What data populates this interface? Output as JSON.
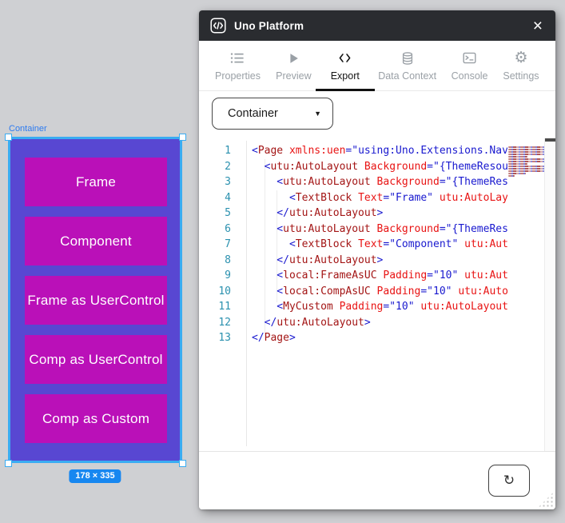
{
  "window": {
    "title": "Uno Platform",
    "icons": {
      "close": "×",
      "caret_down": "▼",
      "refresh": "↻",
      "settings_gear": "⚙"
    }
  },
  "tabs": [
    {
      "id": "properties",
      "label": "Properties",
      "icon": "properties-icon",
      "active": false
    },
    {
      "id": "preview",
      "label": "Preview",
      "icon": "preview-icon",
      "active": false
    },
    {
      "id": "export",
      "label": "Export",
      "icon": "export-icon",
      "active": true
    },
    {
      "id": "data-context",
      "label": "Data Context",
      "icon": "data-context-icon",
      "active": false
    },
    {
      "id": "console",
      "label": "Console",
      "icon": "console-icon",
      "active": false
    },
    {
      "id": "settings",
      "label": "Settings",
      "icon": "settings-icon",
      "active": false
    }
  ],
  "export_panel": {
    "element_selector": {
      "value": "Container"
    },
    "code": {
      "lines": [
        {
          "n": "1",
          "tokens": [
            {
              "c": "d",
              "t": "<"
            },
            {
              "c": "t",
              "t": "Page "
            },
            {
              "c": "a",
              "t": "xmlns:uen"
            },
            {
              "c": "d",
              "t": "=\"using:Uno.Extensions.Navi"
            }
          ]
        },
        {
          "n": "2",
          "tokens": [
            {
              "c": "d",
              "t": "  <"
            },
            {
              "c": "t",
              "t": "utu:AutoLayout "
            },
            {
              "c": "a",
              "t": "Background"
            },
            {
              "c": "d",
              "t": "=\"{ThemeResou"
            }
          ]
        },
        {
          "n": "3",
          "tokens": [
            {
              "c": "d",
              "t": "    <"
            },
            {
              "c": "t",
              "t": "utu:AutoLayout "
            },
            {
              "c": "a",
              "t": "Background"
            },
            {
              "c": "d",
              "t": "=\"{ThemeRes"
            }
          ]
        },
        {
          "n": "4",
          "tokens": [
            {
              "c": "d",
              "t": "      <"
            },
            {
              "c": "t",
              "t": "TextBlock "
            },
            {
              "c": "a",
              "t": "Text"
            },
            {
              "c": "d",
              "t": "=\"Frame\" "
            },
            {
              "c": "a",
              "t": "utu:AutoLay"
            }
          ]
        },
        {
          "n": "5",
          "tokens": [
            {
              "c": "d",
              "t": "    </"
            },
            {
              "c": "t",
              "t": "utu:AutoLayout"
            },
            {
              "c": "d",
              "t": ">"
            }
          ]
        },
        {
          "n": "6",
          "tokens": [
            {
              "c": "d",
              "t": "    <"
            },
            {
              "c": "t",
              "t": "utu:AutoLayout "
            },
            {
              "c": "a",
              "t": "Background"
            },
            {
              "c": "d",
              "t": "=\"{ThemeRes"
            }
          ]
        },
        {
          "n": "7",
          "tokens": [
            {
              "c": "d",
              "t": "      <"
            },
            {
              "c": "t",
              "t": "TextBlock "
            },
            {
              "c": "a",
              "t": "Text"
            },
            {
              "c": "d",
              "t": "=\"Component\" "
            },
            {
              "c": "a",
              "t": "utu:Aut"
            }
          ]
        },
        {
          "n": "8",
          "tokens": [
            {
              "c": "d",
              "t": "    </"
            },
            {
              "c": "t",
              "t": "utu:AutoLayout"
            },
            {
              "c": "d",
              "t": ">"
            }
          ]
        },
        {
          "n": "9",
          "tokens": [
            {
              "c": "d",
              "t": "    <"
            },
            {
              "c": "t",
              "t": "local:FrameAsUC "
            },
            {
              "c": "a",
              "t": "Padding"
            },
            {
              "c": "d",
              "t": "=\"10\" "
            },
            {
              "c": "a",
              "t": "utu:Aut"
            }
          ]
        },
        {
          "n": "10",
          "tokens": [
            {
              "c": "d",
              "t": "    <"
            },
            {
              "c": "t",
              "t": "local:CompAsUC "
            },
            {
              "c": "a",
              "t": "Padding"
            },
            {
              "c": "d",
              "t": "=\"10\" "
            },
            {
              "c": "a",
              "t": "utu:AutoL"
            }
          ]
        },
        {
          "n": "11",
          "tokens": [
            {
              "c": "d",
              "t": "    <"
            },
            {
              "c": "t",
              "t": "MyCustom "
            },
            {
              "c": "a",
              "t": "Padding"
            },
            {
              "c": "d",
              "t": "=\"10\" "
            },
            {
              "c": "a",
              "t": "utu:AutoLayout"
            }
          ]
        },
        {
          "n": "12",
          "tokens": [
            {
              "c": "d",
              "t": "  </"
            },
            {
              "c": "t",
              "t": "utu:AutoLayout"
            },
            {
              "c": "d",
              "t": ">"
            }
          ]
        },
        {
          "n": "13",
          "tokens": [
            {
              "c": "d",
              "t": "</"
            },
            {
              "c": "t",
              "t": "Page"
            },
            {
              "c": "d",
              "t": ">"
            }
          ]
        }
      ]
    }
  },
  "canvas": {
    "selection_label": "Container",
    "size_badge": "178 × 335",
    "buttons": [
      "Frame",
      "Component",
      "Frame as UserControl",
      "Comp as UserControl",
      "Comp as Custom"
    ],
    "colors": {
      "selection_blue": "#3aacf2",
      "container_purple": "#5847d2",
      "button_magenta": "#ba10b8",
      "badge_blue": "#1787f0"
    },
    "button_tops": [
      23,
      97,
      171,
      245,
      319
    ]
  }
}
